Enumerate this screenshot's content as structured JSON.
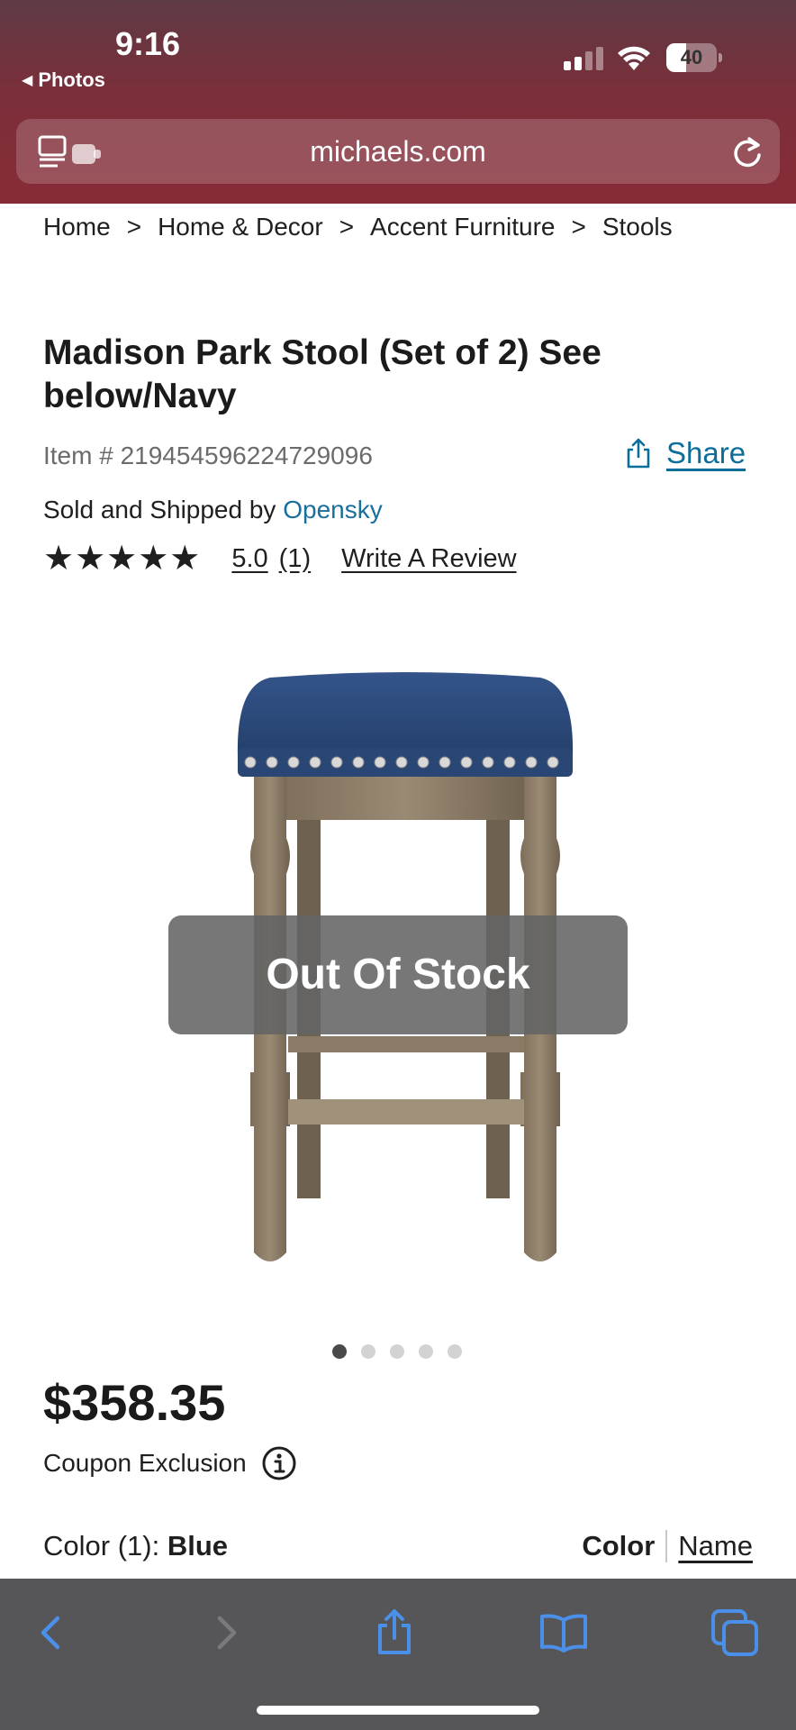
{
  "status_bar": {
    "time": "9:16",
    "back_app": "Photos",
    "battery_level": "40",
    "battery_fraction": 0.4
  },
  "browser": {
    "url": "michaels.com",
    "icons": [
      "reader-icon",
      "reload-icon",
      "back-arrow-icon",
      "forward-arrow-icon",
      "share-icon",
      "bookmarks-icon",
      "tabs-icon"
    ]
  },
  "breadcrumb": {
    "items": [
      "Home",
      "Home & Decor",
      "Accent Furniture",
      "Stools"
    ],
    "separator": ">"
  },
  "product": {
    "title": "Madison Park Stool (Set of 2) See below/Navy",
    "item_number": "Item # 219454596224729096",
    "share_label": "Share",
    "sold_by_prefix": "Sold and Shipped by",
    "vendor": "Opensky",
    "stars": "★★★★★",
    "rating": 5.0,
    "rating_label": "5.0",
    "review_count": "(1)",
    "write_review": "Write A Review",
    "stock_overlay": "Out Of Stock",
    "gallery": {
      "count": 5,
      "active_index": 0
    },
    "price": "$358.35",
    "coupon_exclusion": "Coupon Exclusion",
    "color_label_prefix": "Color (1):",
    "color_value": "Blue",
    "view_option_color": "Color",
    "view_option_name": "Name"
  },
  "colors": {
    "chrome_top": "#5e3a44",
    "chrome_accent": "#872c37",
    "link_blue": "#0b6e9a",
    "toolbar_bg": "#565658",
    "toolbar_icon": "#4a8fe8",
    "seat_navy": "#2c4a78"
  }
}
